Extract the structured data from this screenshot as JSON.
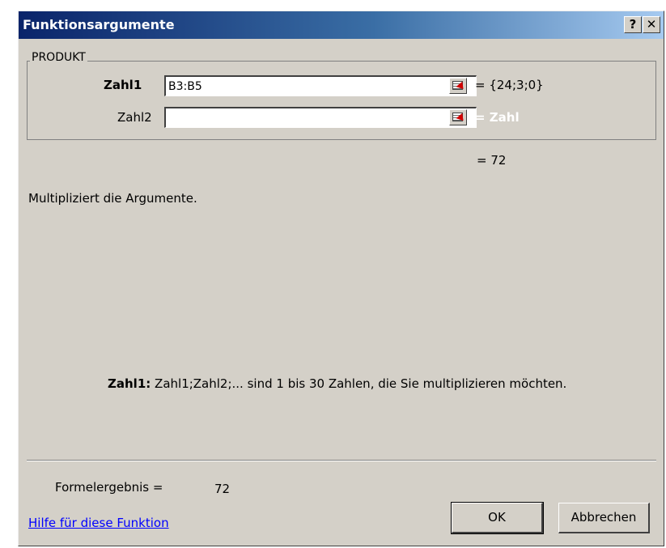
{
  "window": {
    "title": "Funktionsargumente",
    "help_glyph": "?",
    "close_glyph": "✕"
  },
  "function_group": {
    "name": "PRODUKT",
    "args": [
      {
        "label": "Zahl1",
        "bold": true,
        "value": "B3:B5",
        "evaluated": "= {24;3;0}"
      },
      {
        "label": "Zahl2",
        "bold": false,
        "value": "",
        "evaluated": "= Zahl"
      }
    ]
  },
  "result": "= 72",
  "description": "Multipliziert die Argumente.",
  "argument_help": {
    "name": "Zahl1:",
    "text": "Zahl1;Zahl2;... sind 1 bis 30 Zahlen, die Sie multiplizieren möchten."
  },
  "formula_result": {
    "label": "Formelergebnis =",
    "value": "72"
  },
  "help_link": "Hilfe für diese Funktion",
  "buttons": {
    "ok": "OK",
    "cancel": "Abbrechen"
  },
  "icons": {
    "ref_button": "range-select-icon"
  },
  "colors": {
    "dialog_face": "#d4d0c8",
    "title_start": "#0a246a",
    "title_end": "#a6caf0",
    "link": "#0000ff"
  }
}
